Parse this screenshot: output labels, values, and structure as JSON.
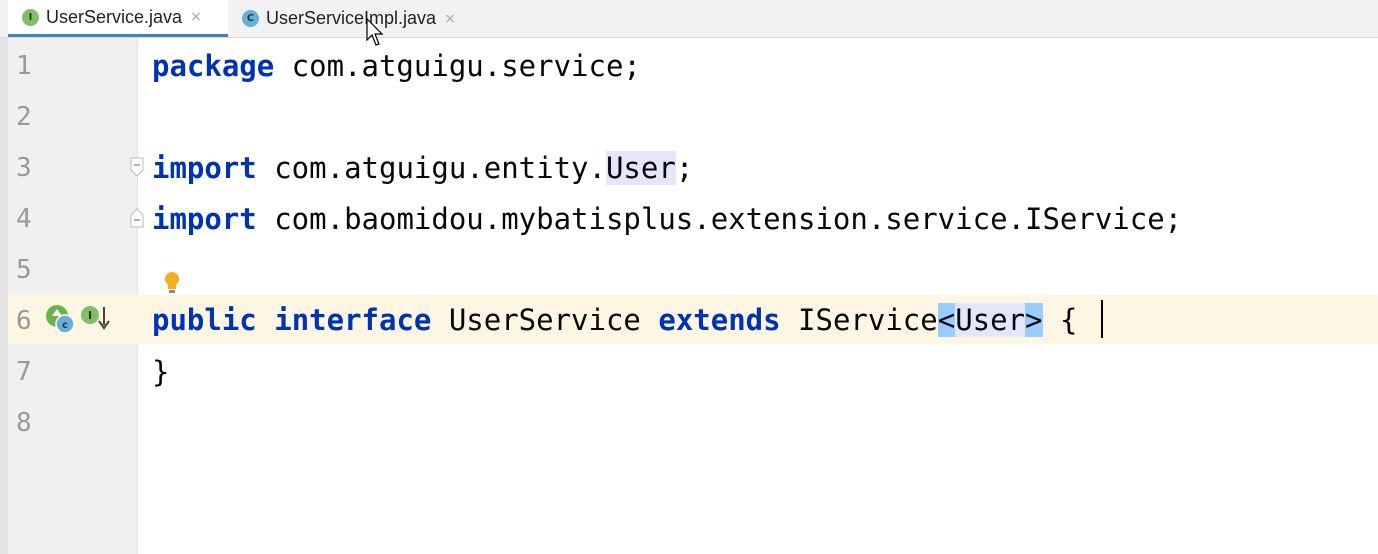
{
  "tabs": [
    {
      "label": "UserService.java",
      "icon": "interface-file-icon",
      "icon_glyph": "I",
      "active": true
    },
    {
      "label": "UserServiceImpl.java",
      "icon": "class-file-icon",
      "icon_glyph": "C",
      "active": false
    }
  ],
  "tab_close_glyph": "×",
  "lines": [
    {
      "num": "1"
    },
    {
      "num": "2"
    },
    {
      "num": "3"
    },
    {
      "num": "4"
    },
    {
      "num": "5"
    },
    {
      "num": "6"
    },
    {
      "num": "7"
    },
    {
      "num": "8"
    }
  ],
  "code": {
    "l1_kw": "package",
    "l1_rest": " com.atguigu.service;",
    "l3_kw": "import",
    "l3_pre": " com.atguigu.entity.",
    "l3_user": "User",
    "l3_end": ";",
    "l4_kw": "import",
    "l4_rest": " com.baomidou.mybatisplus.extension.service.IService;",
    "l6_kw1": "public",
    "l6_kw2": "interface",
    "l6_name": " UserService ",
    "l6_kw3": "extends",
    "l6_iservice": " IService",
    "l6_lt": "<",
    "l6_user": "User",
    "l6_gt": ">",
    "l6_end": " {",
    "l7": "}"
  },
  "colors": {
    "keyword": "#0033b3",
    "current_line": "#fcf6e2",
    "brace_match": "#99ccff",
    "identifier_highlight": "#e5e5fb",
    "active_tab_underline": "#4083c9"
  }
}
